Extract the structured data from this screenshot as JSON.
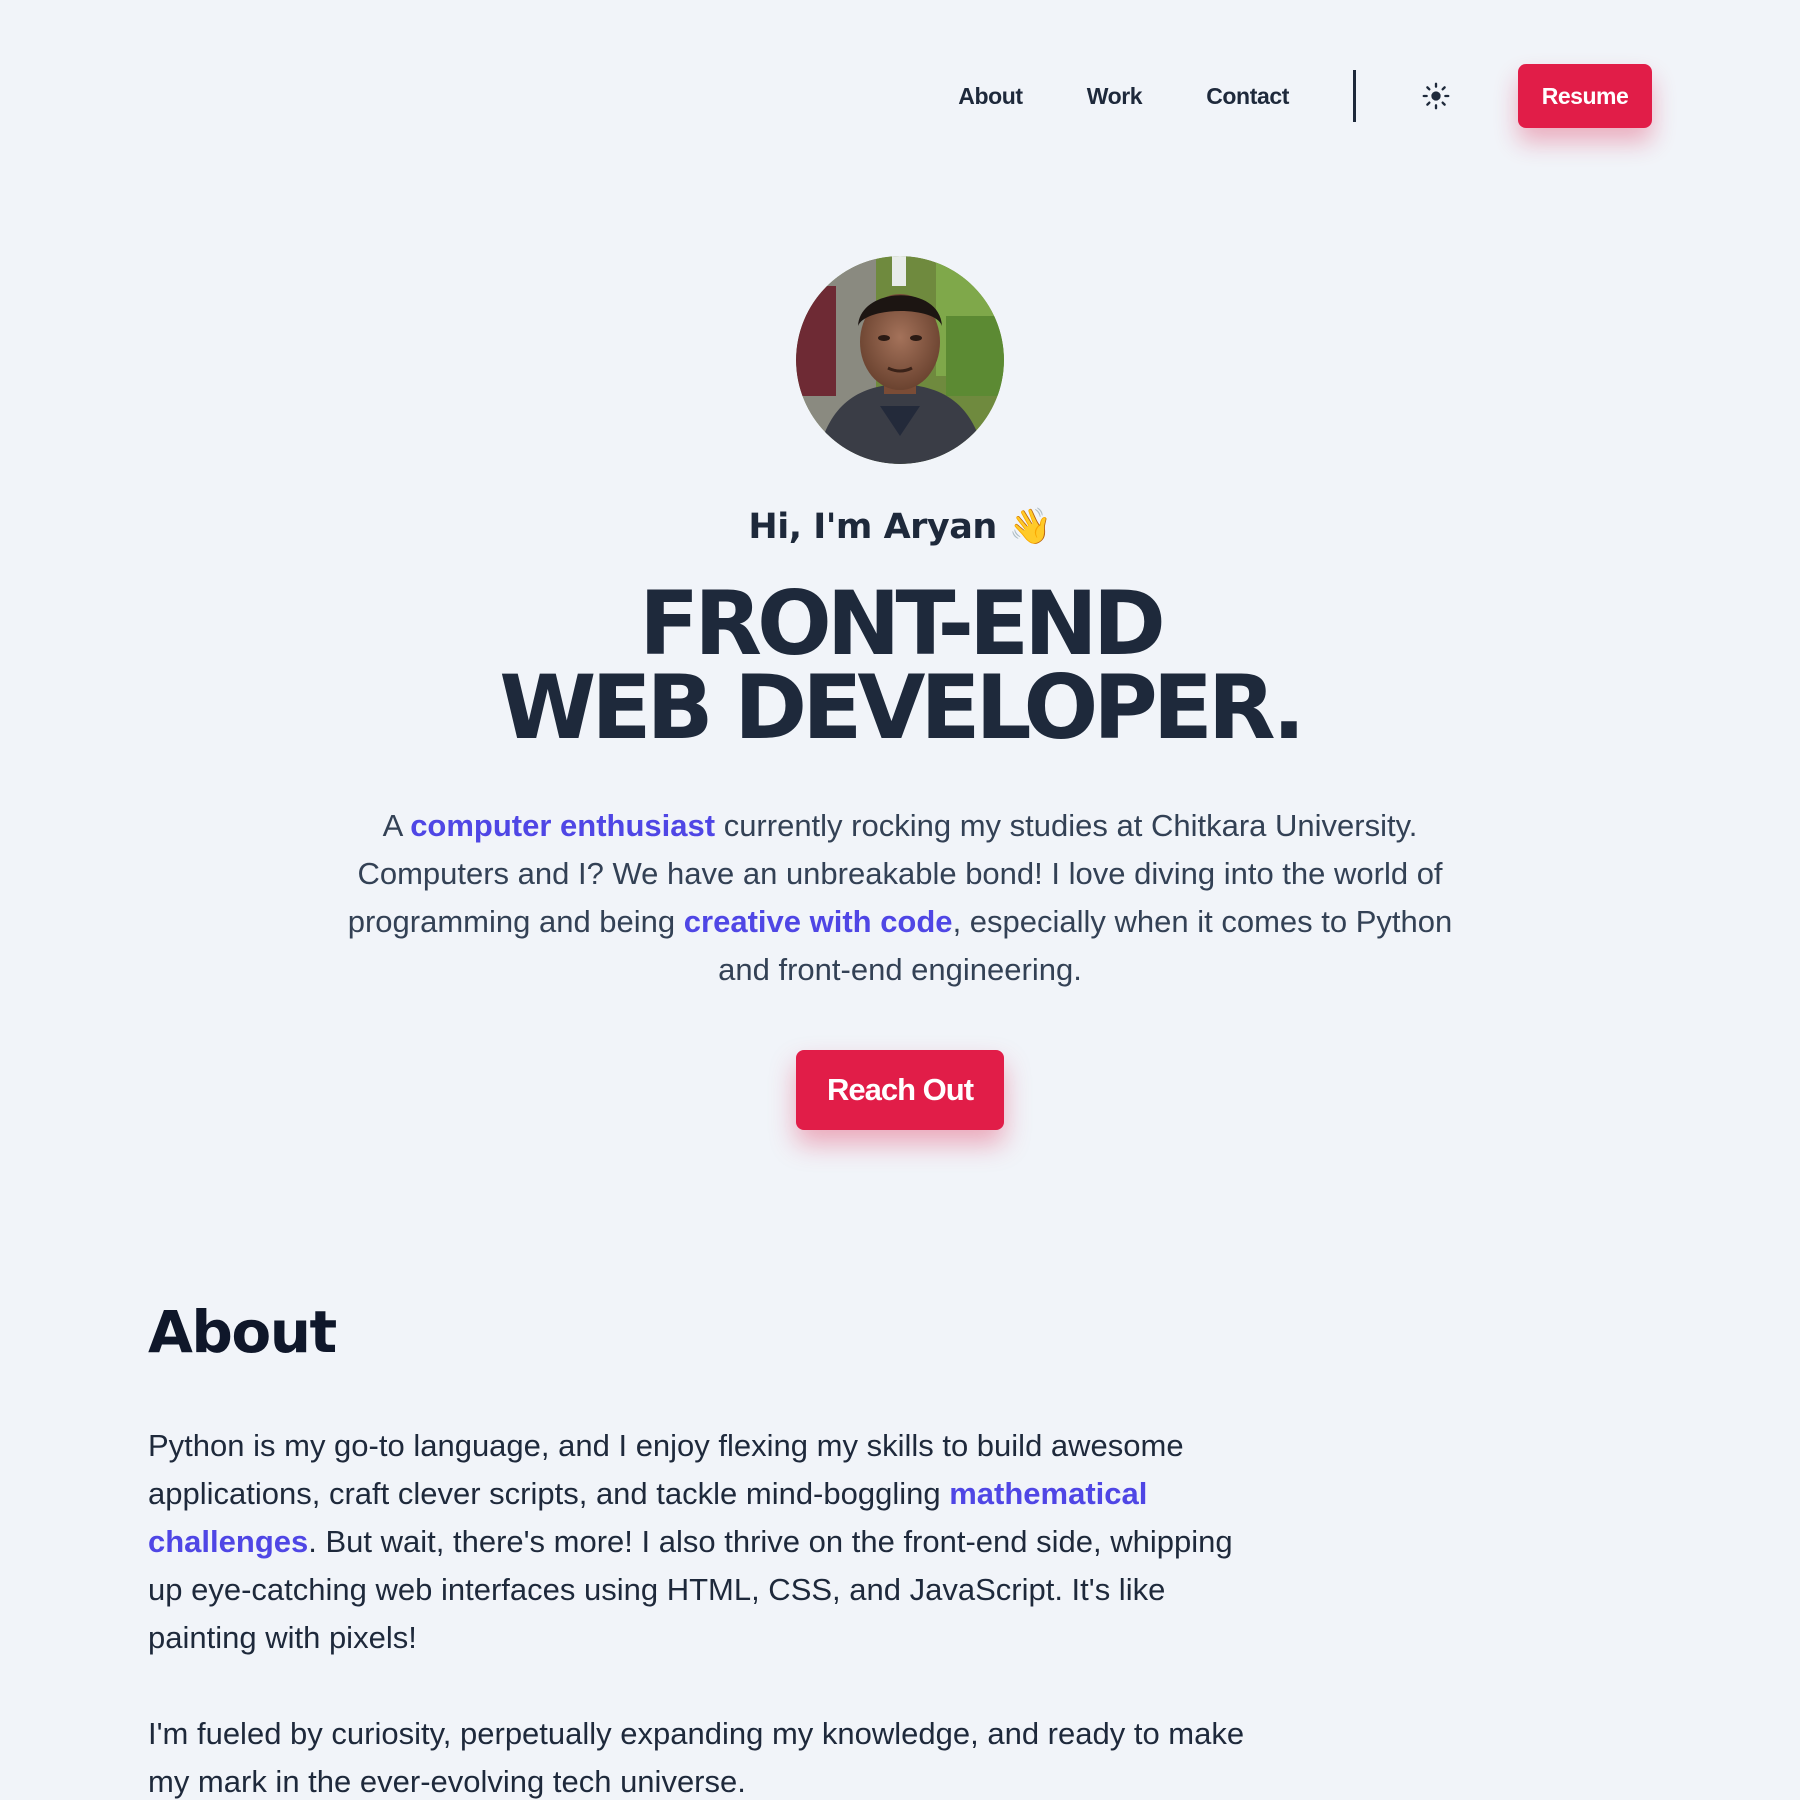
{
  "nav": {
    "links": [
      "About",
      "Work",
      "Contact"
    ],
    "theme_icon": "sun-icon",
    "resume_label": "Resume"
  },
  "hero": {
    "greeting": "Hi, I'm Aryan",
    "wave_emoji": "👋",
    "headline_line1": "FRONT-END",
    "headline_line2": "WEB DEVELOPER.",
    "intro": {
      "p1": "A ",
      "hl1": "computer enthusiast",
      "p2": " currently rocking my studies at Chitkara University. Computers and I? We have an unbreakable bond! I love diving into the world of programming and being ",
      "hl2": "creative with code",
      "p3": ", especially when it comes to Python and front-end engineering."
    },
    "cta_label": "Reach Out"
  },
  "about": {
    "title": "About",
    "para1": {
      "a": "Python is my go-to language, and I enjoy flexing my skills to build awesome applications, craft clever scripts, and tackle mind-boggling ",
      "hl": "mathematical challenges",
      "b": ". But wait, there's more! I also thrive on the front-end side, whipping up eye-catching web interfaces using HTML, CSS, and JavaScript. It's like painting with pixels!"
    },
    "para2": "I'm fueled by curiosity, perpetually expanding my knowledge, and ready to make my mark in the ever-evolving tech universe."
  },
  "colors": {
    "background": "#f1f4f9",
    "text": "#1e293b",
    "accent": "#e11d48",
    "highlight": "#4f46e5"
  }
}
